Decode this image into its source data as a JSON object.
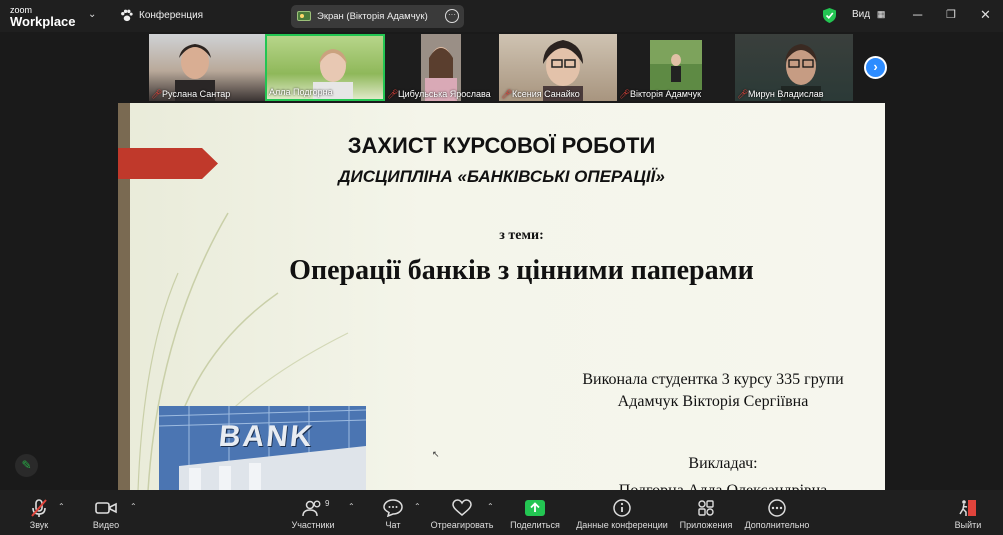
{
  "app": {
    "brand_line1": "zoom",
    "brand_line2": "Workplace"
  },
  "header": {
    "conference_label": "Конференция",
    "screen_share_label": "Экран (Вікторія Адамчук)",
    "view_label": "Вид"
  },
  "participants_strip": [
    {
      "name": "Руслана Сантар",
      "muted": true
    },
    {
      "name": "Алла Подгорна",
      "muted": false,
      "active": true
    },
    {
      "name": "Цибульська Ярослава",
      "muted": true
    },
    {
      "name": "Ксения Санайко",
      "muted": true
    },
    {
      "name": "Вікторія  Адамчук",
      "muted": true
    },
    {
      "name": "Мирун Владислав",
      "muted": true
    }
  ],
  "slide": {
    "title": "ЗАХИСТ КУРСОВОЇ РОБОТИ",
    "subtitle": "ДИСЦИПЛІНА «БАНКІВСЬКІ ОПЕРАЦІЇ»",
    "topic_prefix": "з теми:",
    "topic": "Операції банків з цінними паперами",
    "author_line1": "Виконала студентка 3 курсу 335 групи",
    "author_line2": "Адамчук Вікторія Сергіївна",
    "teacher_label": "Викладач:",
    "teacher_name": "Подгорна Алла Олександрівна",
    "image_text": "BANK"
  },
  "toolbar": {
    "audio": "Звук",
    "video": "Видео",
    "participants": "Участники",
    "participants_count": "9",
    "chat": "Чат",
    "react": "Отреагировать",
    "share": "Поделиться",
    "meeting_info": "Данные конференции",
    "apps": "Приложения",
    "more": "Дополнительно",
    "leave": "Выйти"
  },
  "colors": {
    "accent_green": "#23c552",
    "accent_blue": "#2d8cff",
    "muted_red": "#e0443c",
    "slide_arrow": "#c0392b"
  }
}
